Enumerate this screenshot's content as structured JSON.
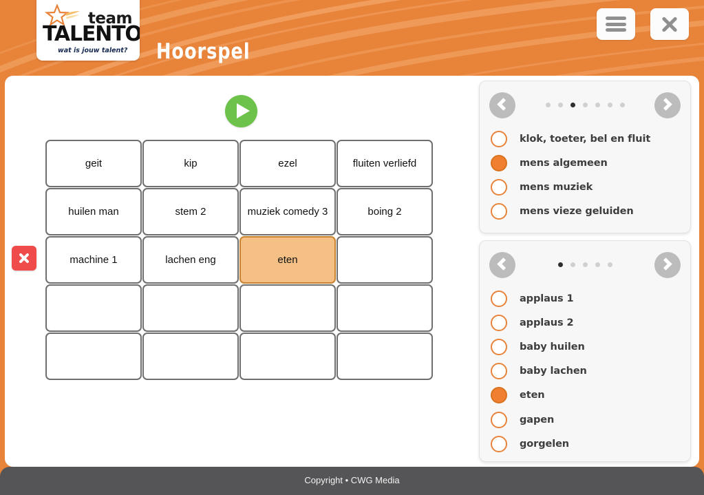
{
  "header": {
    "title": "Hoorspel",
    "logo": {
      "team": "team",
      "name": "TALENTO",
      "tagline": "wat is jouw talent?"
    },
    "menu_button_icon": "hamburger-menu-icon",
    "close_button_icon": "close-icon",
    "background_color": "#E8833A"
  },
  "toolbar": {
    "play_icon": "play-icon",
    "remove_icon": "close-x-icon"
  },
  "grid": {
    "columns": 4,
    "rows": 5,
    "cells": [
      {
        "label": "geit",
        "selected": false
      },
      {
        "label": "kip",
        "selected": false
      },
      {
        "label": "ezel",
        "selected": false
      },
      {
        "label": "fluiten verliefd",
        "selected": false
      },
      {
        "label": "huilen man",
        "selected": false
      },
      {
        "label": "stem 2",
        "selected": false
      },
      {
        "label": "muziek comedy 3",
        "selected": false
      },
      {
        "label": "boing 2",
        "selected": false
      },
      {
        "label": "machine 1",
        "selected": false
      },
      {
        "label": "lachen eng",
        "selected": false
      },
      {
        "label": "eten",
        "selected": true
      },
      {
        "label": "",
        "selected": false
      },
      {
        "label": "",
        "selected": false
      },
      {
        "label": "",
        "selected": false
      },
      {
        "label": "",
        "selected": false
      },
      {
        "label": "",
        "selected": false
      },
      {
        "label": "",
        "selected": false
      },
      {
        "label": "",
        "selected": false
      },
      {
        "label": "",
        "selected": false
      },
      {
        "label": "",
        "selected": false
      }
    ]
  },
  "panels": [
    {
      "name": "categories",
      "prev_icon": "chevron-left-icon",
      "next_icon": "chevron-right-icon",
      "pagination": {
        "total": 7,
        "active_index": 2
      },
      "options": [
        {
          "label": "klok, toeter, bel en fluit",
          "selected": false
        },
        {
          "label": "mens algemeen",
          "selected": true
        },
        {
          "label": "mens muziek",
          "selected": false
        },
        {
          "label": "mens vieze geluiden",
          "selected": false
        }
      ]
    },
    {
      "name": "sounds",
      "prev_icon": "chevron-left-icon",
      "next_icon": "chevron-right-icon",
      "pagination": {
        "total": 5,
        "active_index": 0
      },
      "options": [
        {
          "label": "applaus 1",
          "selected": false
        },
        {
          "label": "applaus 2",
          "selected": false
        },
        {
          "label": "baby huilen",
          "selected": false
        },
        {
          "label": "baby lachen",
          "selected": false
        },
        {
          "label": "eten",
          "selected": true
        },
        {
          "label": "gapen",
          "selected": false
        },
        {
          "label": "gorgelen",
          "selected": false
        }
      ]
    }
  ],
  "footer": {
    "text": "Copyright • CWG Media"
  },
  "colors": {
    "brand_orange": "#E8833A",
    "selected_cell": "#F5C086",
    "play_green": "#6CC24A",
    "remove_red": "#EF4B4B",
    "footer_gray": "#555456"
  }
}
